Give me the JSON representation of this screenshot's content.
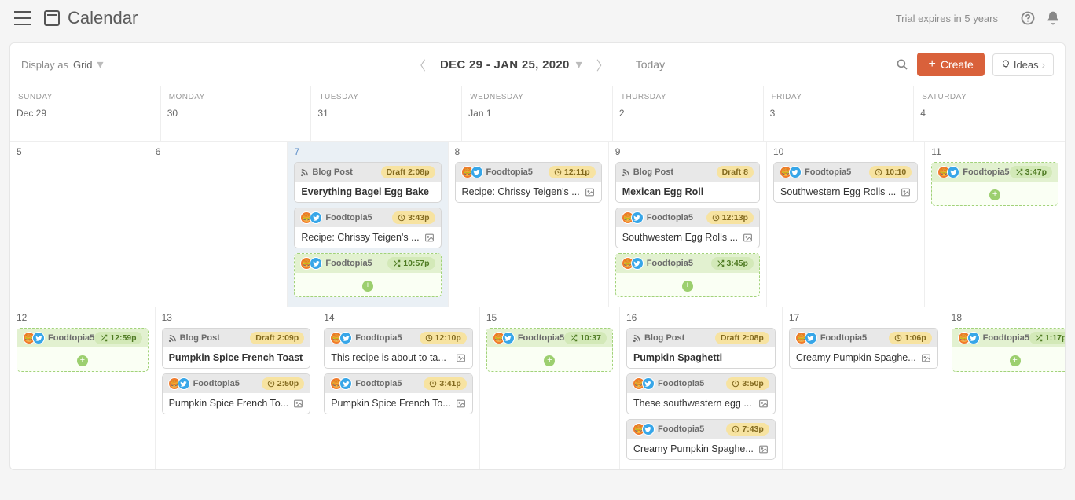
{
  "header": {
    "title": "Calendar",
    "trial_text": "Trial expires in 5 years"
  },
  "toolbar": {
    "display_as_label": "Display as",
    "display_as_value": "Grid",
    "date_range": "DEC 29 - JAN 25, 2020",
    "today_label": "Today",
    "create_label": "Create",
    "ideas_label": "Ideas"
  },
  "days": [
    "SUNDAY",
    "MONDAY",
    "TUESDAY",
    "WEDNESDAY",
    "THURSDAY",
    "FRIDAY",
    "SATURDAY"
  ],
  "weeks": [
    [
      {
        "date": "Dec 29"
      },
      {
        "date": "30"
      },
      {
        "date": "31"
      },
      {
        "date": "Jan 1"
      },
      {
        "date": "2"
      },
      {
        "date": "3"
      },
      {
        "date": "4"
      }
    ],
    [
      {
        "date": "5"
      },
      {
        "date": "6"
      },
      {
        "date": "7",
        "today": true,
        "cards": [
          {
            "type": "blog",
            "label": "Blog Post",
            "status": "Draft",
            "time": "2:08p",
            "title": "Everything Bagel Egg Bake",
            "bold": true
          },
          {
            "type": "social",
            "label": "Foodtopia5",
            "pill": "clock",
            "time": "3:43p",
            "title": "Recipe: Chrissy Teigen's ...",
            "img": true
          },
          {
            "type": "dashed",
            "label": "Foodtopia5",
            "pill": "shuffle",
            "time": "10:57p"
          }
        ]
      },
      {
        "date": "8",
        "cards": [
          {
            "type": "social",
            "label": "Foodtopia5",
            "pill": "clock",
            "time": "12:11p",
            "title": "Recipe: Chrissy Teigen's ...",
            "img": true
          }
        ]
      },
      {
        "date": "9",
        "cards": [
          {
            "type": "blog",
            "label": "Blog Post",
            "status": "Draft",
            "time": "8",
            "title": "Mexican Egg Roll",
            "bold": true
          },
          {
            "type": "social",
            "label": "Foodtopia5",
            "pill": "clock",
            "time": "12:13p",
            "title": "Southwestern Egg Rolls ...",
            "img": true
          },
          {
            "type": "dashed",
            "label": "Foodtopia5",
            "pill": "shuffle",
            "time": "3:45p"
          }
        ]
      },
      {
        "date": "10",
        "cards": [
          {
            "type": "social",
            "label": "Foodtopia5",
            "pill": "clock",
            "time": "10:10",
            "title": "Southwestern Egg Rolls ...",
            "img": true
          }
        ]
      },
      {
        "date": "11",
        "cards": [
          {
            "type": "dashed",
            "label": "Foodtopia5",
            "pill": "shuffle",
            "time": "3:47p"
          }
        ]
      }
    ],
    [
      {
        "date": "12",
        "cards": [
          {
            "type": "dashed",
            "label": "Foodtopia5",
            "pill": "shuffle",
            "time": "12:59p"
          }
        ]
      },
      {
        "date": "13",
        "cards": [
          {
            "type": "blog",
            "label": "Blog Post",
            "status": "Draft",
            "time": "2:09p",
            "title": "Pumpkin Spice French Toast",
            "bold": true,
            "wrap": true
          },
          {
            "type": "social",
            "label": "Foodtopia5",
            "pill": "clock",
            "time": "2:50p",
            "title": "Pumpkin Spice French To...",
            "img": true
          }
        ]
      },
      {
        "date": "14",
        "cards": [
          {
            "type": "social",
            "label": "Foodtopia5",
            "pill": "clock",
            "time": "12:10p",
            "title": "This recipe is about to ta...",
            "img": true
          },
          {
            "type": "social",
            "label": "Foodtopia5",
            "pill": "clock",
            "time": "3:41p",
            "title": "Pumpkin Spice French To...",
            "img": true
          }
        ]
      },
      {
        "date": "15",
        "cards": [
          {
            "type": "dashed",
            "label": "Foodtopia5",
            "pill": "shuffle",
            "time": "10:37"
          }
        ]
      },
      {
        "date": "16",
        "cards": [
          {
            "type": "blog",
            "label": "Blog Post",
            "status": "Draft",
            "time": "2:08p",
            "title": "Pumpkin Spaghetti",
            "bold": true
          },
          {
            "type": "social",
            "label": "Foodtopia5",
            "pill": "clock",
            "time": "3:50p",
            "title": "These southwestern egg ...",
            "img": true
          },
          {
            "type": "social",
            "label": "Foodtopia5",
            "pill": "clock",
            "time": "7:43p",
            "title": "Creamy Pumpkin Spaghe...",
            "img": true
          }
        ]
      },
      {
        "date": "17",
        "cards": [
          {
            "type": "social",
            "label": "Foodtopia5",
            "pill": "clock",
            "time": "1:06p",
            "title": "Creamy Pumpkin Spaghe...",
            "img": true
          }
        ]
      },
      {
        "date": "18",
        "cards": [
          {
            "type": "dashed",
            "label": "Foodtopia5",
            "pill": "shuffle",
            "time": "1:17p"
          }
        ]
      }
    ]
  ]
}
